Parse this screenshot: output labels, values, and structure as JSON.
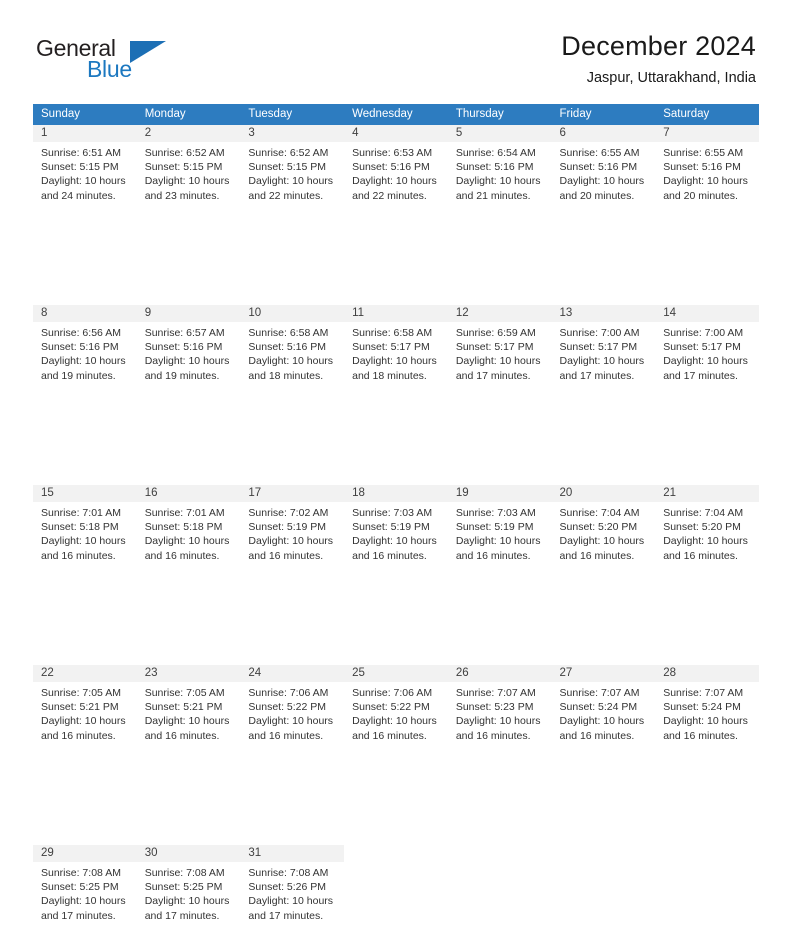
{
  "brand": {
    "line1": "General",
    "line2": "Blue",
    "triangle_color": "#1c6fb5",
    "blue_text_color": "#1c78c0"
  },
  "header": {
    "title": "December 2024",
    "subtitle": "Jaspur, Uttarakhand, India"
  },
  "theme": {
    "header_row_bg": "#2d7cc0",
    "header_row_text": "#ffffff",
    "daynum_bg": "#f2f2f2",
    "cell_text": "#333333"
  },
  "calendar": {
    "weekday_headers": [
      "Sunday",
      "Monday",
      "Tuesday",
      "Wednesday",
      "Thursday",
      "Friday",
      "Saturday"
    ],
    "weeks": [
      [
        {
          "day": "1",
          "sunrise": "Sunrise: 6:51 AM",
          "sunset": "Sunset: 5:15 PM",
          "daylight1": "Daylight: 10 hours",
          "daylight2": "and 24 minutes."
        },
        {
          "day": "2",
          "sunrise": "Sunrise: 6:52 AM",
          "sunset": "Sunset: 5:15 PM",
          "daylight1": "Daylight: 10 hours",
          "daylight2": "and 23 minutes."
        },
        {
          "day": "3",
          "sunrise": "Sunrise: 6:52 AM",
          "sunset": "Sunset: 5:15 PM",
          "daylight1": "Daylight: 10 hours",
          "daylight2": "and 22 minutes."
        },
        {
          "day": "4",
          "sunrise": "Sunrise: 6:53 AM",
          "sunset": "Sunset: 5:16 PM",
          "daylight1": "Daylight: 10 hours",
          "daylight2": "and 22 minutes."
        },
        {
          "day": "5",
          "sunrise": "Sunrise: 6:54 AM",
          "sunset": "Sunset: 5:16 PM",
          "daylight1": "Daylight: 10 hours",
          "daylight2": "and 21 minutes."
        },
        {
          "day": "6",
          "sunrise": "Sunrise: 6:55 AM",
          "sunset": "Sunset: 5:16 PM",
          "daylight1": "Daylight: 10 hours",
          "daylight2": "and 20 minutes."
        },
        {
          "day": "7",
          "sunrise": "Sunrise: 6:55 AM",
          "sunset": "Sunset: 5:16 PM",
          "daylight1": "Daylight: 10 hours",
          "daylight2": "and 20 minutes."
        }
      ],
      [
        {
          "day": "8",
          "sunrise": "Sunrise: 6:56 AM",
          "sunset": "Sunset: 5:16 PM",
          "daylight1": "Daylight: 10 hours",
          "daylight2": "and 19 minutes."
        },
        {
          "day": "9",
          "sunrise": "Sunrise: 6:57 AM",
          "sunset": "Sunset: 5:16 PM",
          "daylight1": "Daylight: 10 hours",
          "daylight2": "and 19 minutes."
        },
        {
          "day": "10",
          "sunrise": "Sunrise: 6:58 AM",
          "sunset": "Sunset: 5:16 PM",
          "daylight1": "Daylight: 10 hours",
          "daylight2": "and 18 minutes."
        },
        {
          "day": "11",
          "sunrise": "Sunrise: 6:58 AM",
          "sunset": "Sunset: 5:17 PM",
          "daylight1": "Daylight: 10 hours",
          "daylight2": "and 18 minutes."
        },
        {
          "day": "12",
          "sunrise": "Sunrise: 6:59 AM",
          "sunset": "Sunset: 5:17 PM",
          "daylight1": "Daylight: 10 hours",
          "daylight2": "and 17 minutes."
        },
        {
          "day": "13",
          "sunrise": "Sunrise: 7:00 AM",
          "sunset": "Sunset: 5:17 PM",
          "daylight1": "Daylight: 10 hours",
          "daylight2": "and 17 minutes."
        },
        {
          "day": "14",
          "sunrise": "Sunrise: 7:00 AM",
          "sunset": "Sunset: 5:17 PM",
          "daylight1": "Daylight: 10 hours",
          "daylight2": "and 17 minutes."
        }
      ],
      [
        {
          "day": "15",
          "sunrise": "Sunrise: 7:01 AM",
          "sunset": "Sunset: 5:18 PM",
          "daylight1": "Daylight: 10 hours",
          "daylight2": "and 16 minutes."
        },
        {
          "day": "16",
          "sunrise": "Sunrise: 7:01 AM",
          "sunset": "Sunset: 5:18 PM",
          "daylight1": "Daylight: 10 hours",
          "daylight2": "and 16 minutes."
        },
        {
          "day": "17",
          "sunrise": "Sunrise: 7:02 AM",
          "sunset": "Sunset: 5:19 PM",
          "daylight1": "Daylight: 10 hours",
          "daylight2": "and 16 minutes."
        },
        {
          "day": "18",
          "sunrise": "Sunrise: 7:03 AM",
          "sunset": "Sunset: 5:19 PM",
          "daylight1": "Daylight: 10 hours",
          "daylight2": "and 16 minutes."
        },
        {
          "day": "19",
          "sunrise": "Sunrise: 7:03 AM",
          "sunset": "Sunset: 5:19 PM",
          "daylight1": "Daylight: 10 hours",
          "daylight2": "and 16 minutes."
        },
        {
          "day": "20",
          "sunrise": "Sunrise: 7:04 AM",
          "sunset": "Sunset: 5:20 PM",
          "daylight1": "Daylight: 10 hours",
          "daylight2": "and 16 minutes."
        },
        {
          "day": "21",
          "sunrise": "Sunrise: 7:04 AM",
          "sunset": "Sunset: 5:20 PM",
          "daylight1": "Daylight: 10 hours",
          "daylight2": "and 16 minutes."
        }
      ],
      [
        {
          "day": "22",
          "sunrise": "Sunrise: 7:05 AM",
          "sunset": "Sunset: 5:21 PM",
          "daylight1": "Daylight: 10 hours",
          "daylight2": "and 16 minutes."
        },
        {
          "day": "23",
          "sunrise": "Sunrise: 7:05 AM",
          "sunset": "Sunset: 5:21 PM",
          "daylight1": "Daylight: 10 hours",
          "daylight2": "and 16 minutes."
        },
        {
          "day": "24",
          "sunrise": "Sunrise: 7:06 AM",
          "sunset": "Sunset: 5:22 PM",
          "daylight1": "Daylight: 10 hours",
          "daylight2": "and 16 minutes."
        },
        {
          "day": "25",
          "sunrise": "Sunrise: 7:06 AM",
          "sunset": "Sunset: 5:22 PM",
          "daylight1": "Daylight: 10 hours",
          "daylight2": "and 16 minutes."
        },
        {
          "day": "26",
          "sunrise": "Sunrise: 7:07 AM",
          "sunset": "Sunset: 5:23 PM",
          "daylight1": "Daylight: 10 hours",
          "daylight2": "and 16 minutes."
        },
        {
          "day": "27",
          "sunrise": "Sunrise: 7:07 AM",
          "sunset": "Sunset: 5:24 PM",
          "daylight1": "Daylight: 10 hours",
          "daylight2": "and 16 minutes."
        },
        {
          "day": "28",
          "sunrise": "Sunrise: 7:07 AM",
          "sunset": "Sunset: 5:24 PM",
          "daylight1": "Daylight: 10 hours",
          "daylight2": "and 16 minutes."
        }
      ],
      [
        {
          "day": "29",
          "sunrise": "Sunrise: 7:08 AM",
          "sunset": "Sunset: 5:25 PM",
          "daylight1": "Daylight: 10 hours",
          "daylight2": "and 17 minutes."
        },
        {
          "day": "30",
          "sunrise": "Sunrise: 7:08 AM",
          "sunset": "Sunset: 5:25 PM",
          "daylight1": "Daylight: 10 hours",
          "daylight2": "and 17 minutes."
        },
        {
          "day": "31",
          "sunrise": "Sunrise: 7:08 AM",
          "sunset": "Sunset: 5:26 PM",
          "daylight1": "Daylight: 10 hours",
          "daylight2": "and 17 minutes."
        },
        {
          "day": "",
          "sunrise": "",
          "sunset": "",
          "daylight1": "",
          "daylight2": ""
        },
        {
          "day": "",
          "sunrise": "",
          "sunset": "",
          "daylight1": "",
          "daylight2": ""
        },
        {
          "day": "",
          "sunrise": "",
          "sunset": "",
          "daylight1": "",
          "daylight2": ""
        },
        {
          "day": "",
          "sunrise": "",
          "sunset": "",
          "daylight1": "",
          "daylight2": ""
        }
      ]
    ]
  }
}
